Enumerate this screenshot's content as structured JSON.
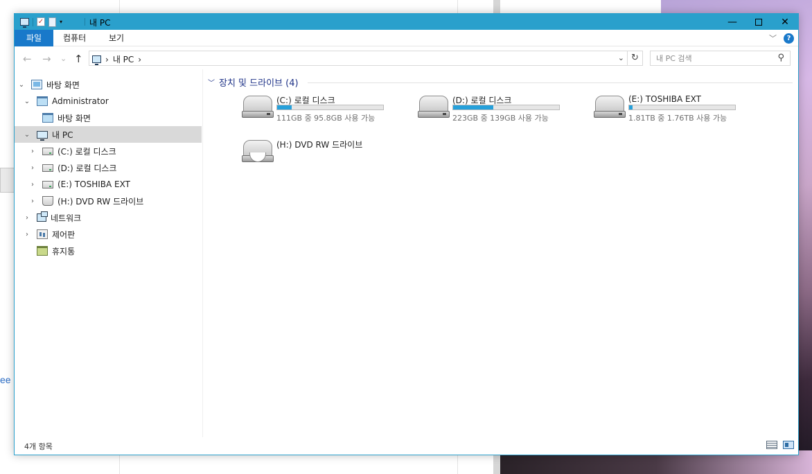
{
  "titlebar": {
    "title": "내 PC",
    "icons": [
      "pc-icon",
      "properties-icon",
      "new-folder-icon",
      "quick-access-dropdown-icon"
    ],
    "controls": {
      "minimize": "—",
      "maximize": "",
      "close": "✕"
    }
  },
  "ribbon": {
    "tabs": [
      {
        "label": "파일",
        "active": true
      },
      {
        "label": "컴퓨터",
        "active": false
      },
      {
        "label": "보기",
        "active": false
      }
    ],
    "expand_glyph": "﹀",
    "help": "?"
  },
  "address": {
    "back": "←",
    "forward": "→",
    "recent": "⌄",
    "up": "↑",
    "crumbs": [
      "›",
      "내 PC",
      "›"
    ],
    "dropdown": "⌄",
    "refresh": "↻"
  },
  "search": {
    "placeholder": "내 PC 검색",
    "icon": "⚲"
  },
  "nav": {
    "items": [
      {
        "label": "바탕 화면",
        "expander": "⌄",
        "icon": "desktop-icon"
      },
      {
        "label": "Administrator",
        "expander": "⌄",
        "icon": "user-folder-icon"
      },
      {
        "label": "바탕 화면",
        "expander": "",
        "icon": "folder-icon"
      },
      {
        "label": "내 PC",
        "expander": "⌄",
        "icon": "pc-icon",
        "selected": true
      },
      {
        "label": "(C:) 로컬 디스크",
        "expander": "›",
        "icon": "drive-icon"
      },
      {
        "label": "(D:) 로컬 디스크",
        "expander": "›",
        "icon": "drive-icon"
      },
      {
        "label": "(E:) TOSHIBA EXT",
        "expander": "›",
        "icon": "drive-icon"
      },
      {
        "label": "(H:) DVD RW 드라이브",
        "expander": "›",
        "icon": "dvd-drive-icon"
      },
      {
        "label": "네트워크",
        "expander": "›",
        "icon": "network-icon"
      },
      {
        "label": "제어판",
        "expander": "›",
        "icon": "control-panel-icon"
      },
      {
        "label": "휴지통",
        "expander": "",
        "icon": "recycle-bin-icon"
      }
    ]
  },
  "content": {
    "group_label": "장치 및 드라이브 (4)",
    "group_chevron": "﹀",
    "drives": [
      {
        "name": "(C:) 로컬 디스크",
        "free_text": "111GB 중 95.8GB 사용 가능",
        "used_fraction": 0.14,
        "icon": "hard-drive-icon"
      },
      {
        "name": "(D:) 로컬 디스크",
        "free_text": "223GB 중 139GB 사용 가능",
        "used_fraction": 0.38,
        "icon": "hard-drive-icon"
      },
      {
        "name": "(E:) TOSHIBA EXT",
        "free_text": "1.81TB 중 1.76TB 사용 가능",
        "used_fraction": 0.03,
        "icon": "hard-drive-icon"
      },
      {
        "name": "(H:) DVD RW 드라이브",
        "free_text": "",
        "used_fraction": null,
        "icon": "dvd-drive-icon"
      }
    ]
  },
  "status": {
    "item_count": "4개 항목"
  },
  "background": {
    "fragment_text": "ee",
    "accent": "#2aa0cc",
    "selection": "#d9d9d9",
    "bar_fill": "#26a0da"
  }
}
